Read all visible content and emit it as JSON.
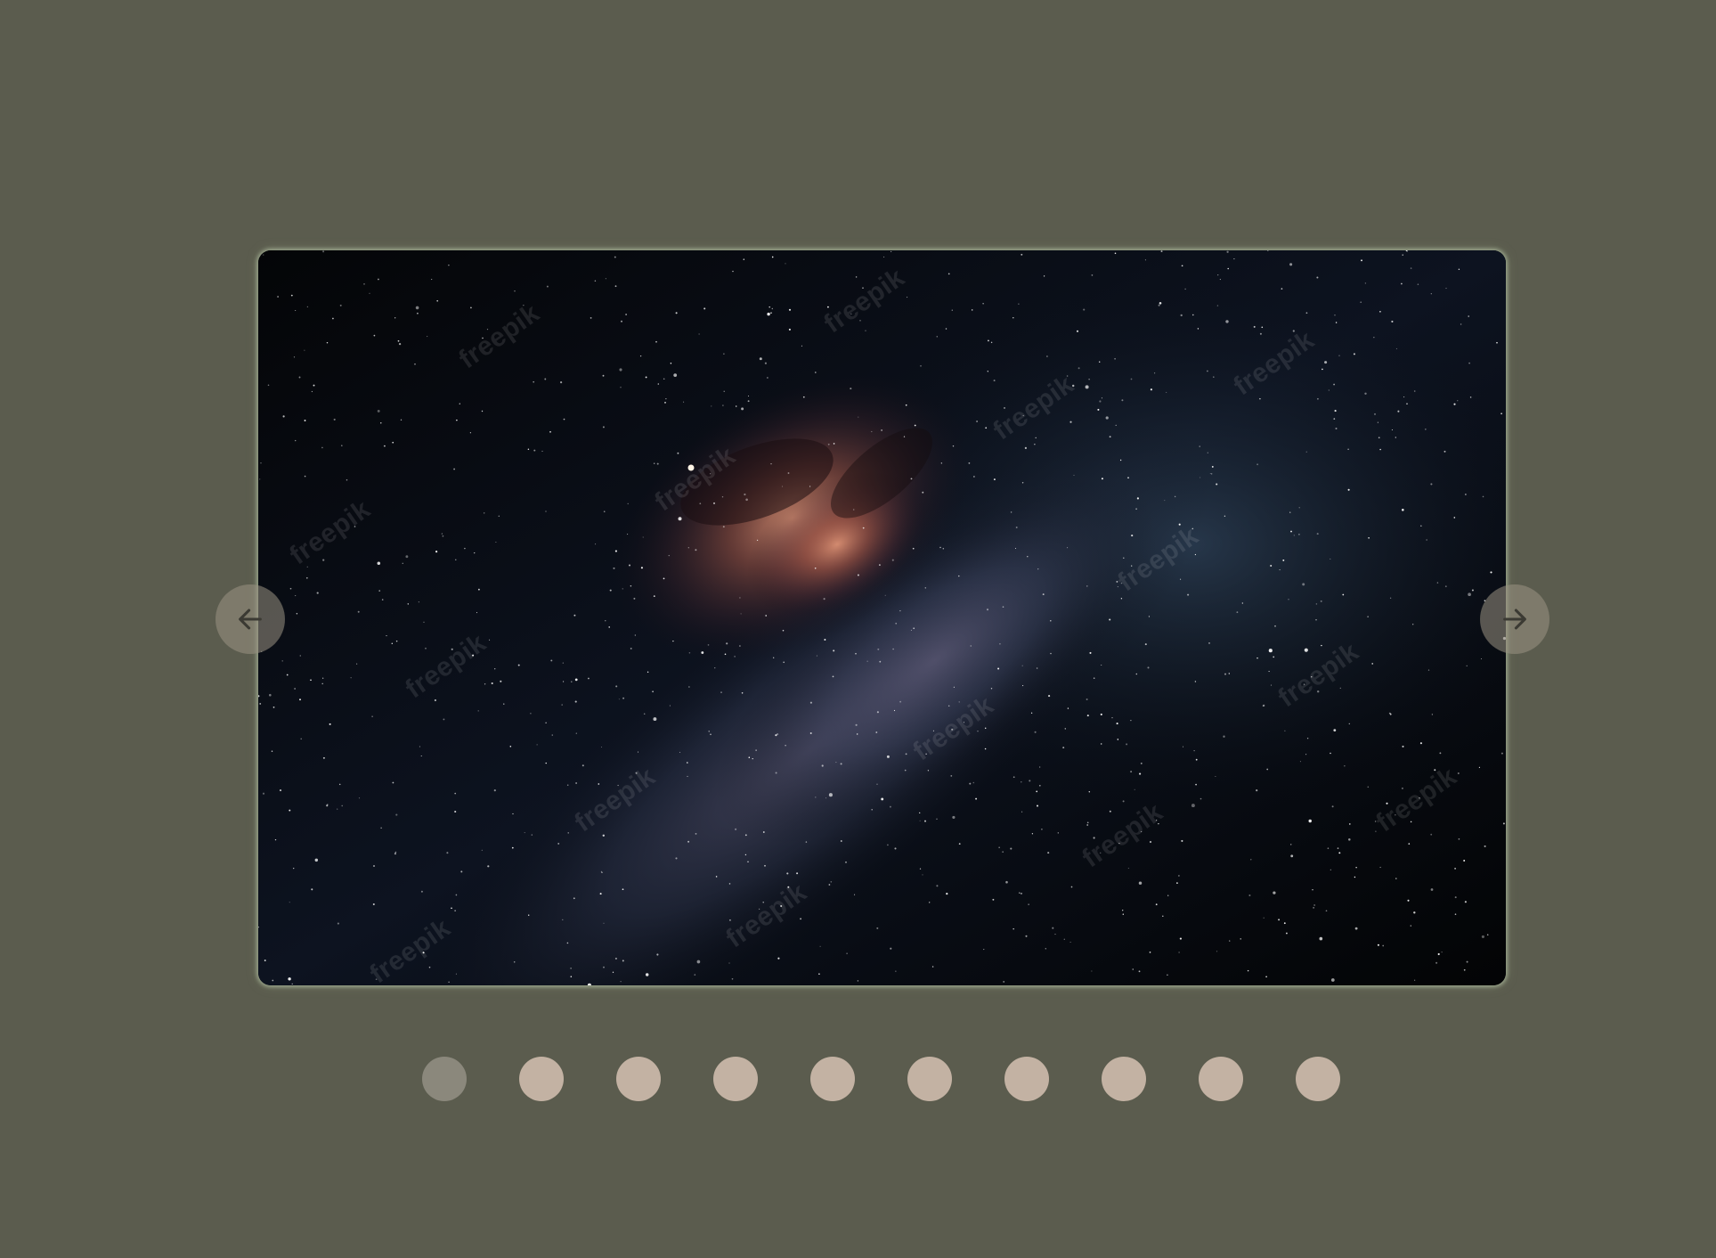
{
  "carousel": {
    "slide_image": "milky-way-night-sky",
    "watermark_text": "freepik",
    "prev_icon": "arrow-left-icon",
    "next_icon": "arrow-right-icon",
    "total_slides": 10,
    "active_slide": 1,
    "colors": {
      "background": "#5b5c4e",
      "dot": "#c3b2a3",
      "dot_active": "#8b887c",
      "nav_button": "#9b9484",
      "frame_glow": "#c4d6b4"
    }
  }
}
